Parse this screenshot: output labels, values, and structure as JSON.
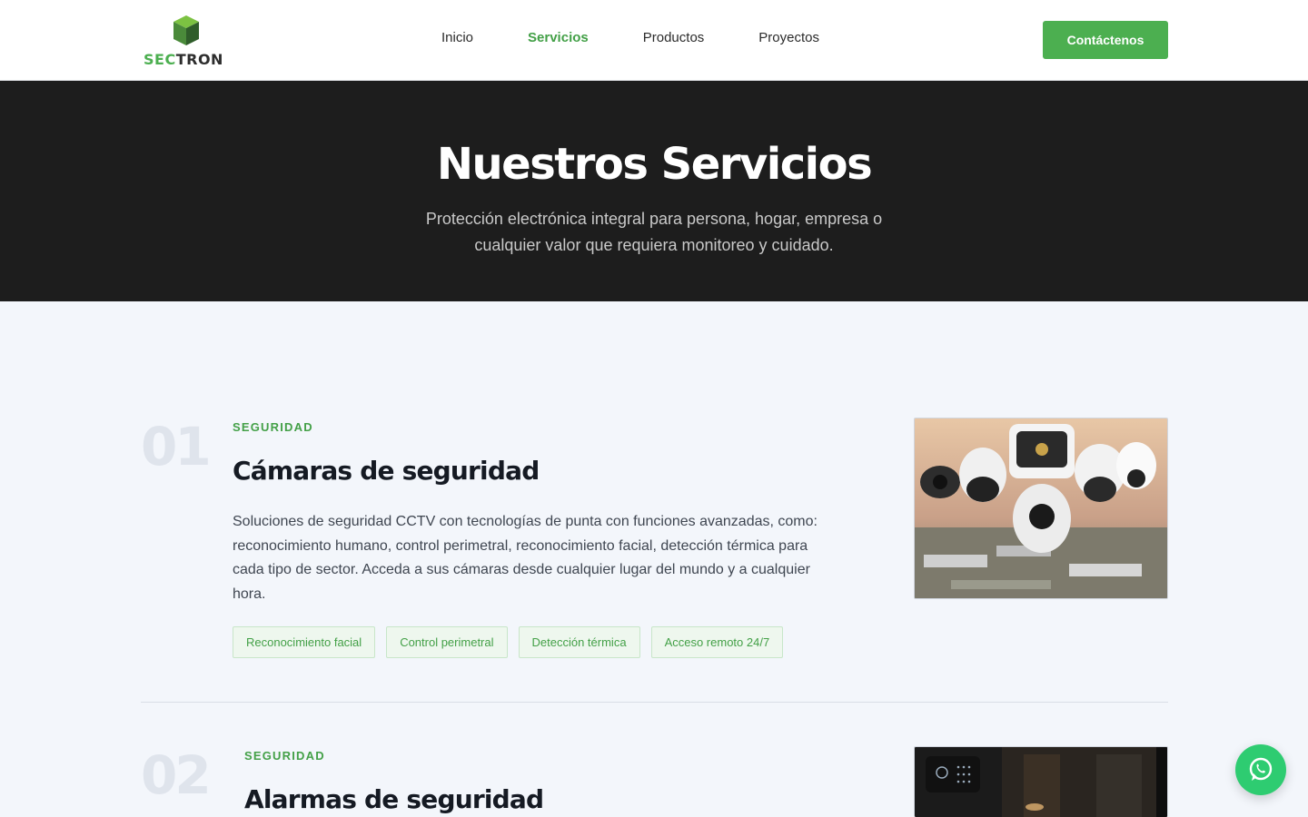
{
  "brand": {
    "name_part1": "SEC",
    "name_part2": "TRON"
  },
  "nav": {
    "items": [
      {
        "label": "Inicio",
        "active": false
      },
      {
        "label": "Servicios",
        "active": true
      },
      {
        "label": "Productos",
        "active": false
      },
      {
        "label": "Proyectos",
        "active": false
      }
    ],
    "cta_label": "Contáctenos"
  },
  "hero": {
    "title": "Nuestros Servicios",
    "subtitle": "Protección electrónica integral para persona, hogar, empresa o cualquier valor que requiera monitoreo y cuidado."
  },
  "services": [
    {
      "number": "01",
      "category": "SEGURIDAD",
      "title": "Cámaras de seguridad",
      "description": "Soluciones de seguridad CCTV con tecnologías de punta con funciones avanzadas, como: reconocimiento humano, control perimetral, reconocimiento facial, detección térmica para cada tipo de sector. Acceda a sus cámaras desde cualquier lugar del mundo y a cualquier hora.",
      "tags": [
        "Reconocimiento facial",
        "Control perimetral",
        "Detección térmica",
        "Acceso remoto 24/7"
      ],
      "image_icon": "security-cameras-image"
    },
    {
      "number": "02",
      "category": "SEGURIDAD",
      "title": "Alarmas de seguridad",
      "image_icon": "alarm-panel-image"
    }
  ],
  "colors": {
    "accent": "#4caf50",
    "hero_bg": "#1d1d1d",
    "page_bg": "#f3f6fb",
    "whatsapp": "#2ecc71"
  },
  "floating": {
    "icon": "whatsapp-icon"
  }
}
